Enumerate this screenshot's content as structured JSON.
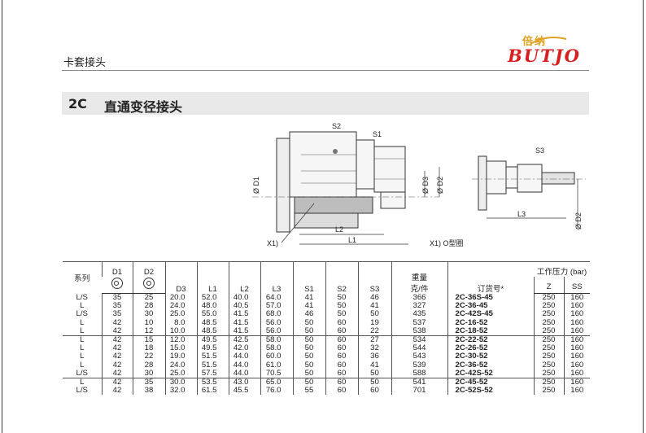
{
  "logo": {
    "top": "倍纳",
    "text": "BUTJO"
  },
  "category_title": "卡套接头",
  "section": {
    "code": "2C",
    "name": "直通变径接头"
  },
  "drawing": {
    "labels": {
      "s1": "S1",
      "s2": "S2",
      "s3": "S3",
      "d1": "Ø D1",
      "d2": "Ø D2",
      "d3": "Ø D3",
      "d2b": "Ø D2",
      "l1": "L1",
      "l2": "L2",
      "l3": "L3",
      "x1": "X1)",
      "note": "X1) O型圈"
    }
  },
  "table": {
    "pressure_header": "工作压力 (bar)",
    "headers": {
      "series": "系列",
      "d1": "D1",
      "d2": "D2",
      "d3": "D3",
      "l1": "L1",
      "l2": "L2",
      "l3": "L3",
      "s1": "S1",
      "s2": "S2",
      "s3": "S3",
      "weight": "重量\n克/件",
      "order": "订货号*",
      "z": "Z",
      "ss": "SS"
    },
    "groups": [
      [
        [
          "L/S",
          "35",
          "25",
          "20.0",
          "52.0",
          "40.0",
          "64.0",
          "41",
          "50",
          "46",
          "366",
          "2C-36S-45",
          "250",
          "160"
        ],
        [
          "L",
          "35",
          "28",
          "24.0",
          "48.0",
          "40.5",
          "57.0",
          "41",
          "50",
          "41",
          "327",
          "2C-36-45",
          "250",
          "160"
        ],
        [
          "L/S",
          "35",
          "30",
          "25.0",
          "55.0",
          "41.5",
          "68.0",
          "46",
          "50",
          "50",
          "435",
          "2C-42S-45",
          "250",
          "160"
        ],
        [
          "L",
          "42",
          "10",
          "8.0",
          "48.5",
          "41.5",
          "56.0",
          "50",
          "60",
          "19",
          "537",
          "2C-16-52",
          "250",
          "160"
        ],
        [
          "L",
          "42",
          "12",
          "10.0",
          "48.5",
          "41.5",
          "56.0",
          "50",
          "60",
          "22",
          "538",
          "2C-18-52",
          "250",
          "160"
        ]
      ],
      [
        [
          "L",
          "42",
          "15",
          "12.0",
          "49.5",
          "42.5",
          "58.0",
          "50",
          "60",
          "27",
          "534",
          "2C-22-52",
          "250",
          "160"
        ],
        [
          "L",
          "42",
          "18",
          "15.0",
          "49.5",
          "42.0",
          "58.0",
          "50",
          "60",
          "32",
          "544",
          "2C-26-52",
          "250",
          "160"
        ],
        [
          "L",
          "42",
          "22",
          "19.0",
          "51.5",
          "44.0",
          "60.0",
          "50",
          "60",
          "36",
          "543",
          "2C-30-52",
          "250",
          "160"
        ],
        [
          "L",
          "42",
          "28",
          "24.0",
          "51.5",
          "44.0",
          "61.0",
          "50",
          "60",
          "41",
          "539",
          "2C-36-52",
          "250",
          "160"
        ],
        [
          "L/S",
          "42",
          "30",
          "25.0",
          "57.5",
          "44.0",
          "70.5",
          "50",
          "60",
          "50",
          "588",
          "2C-42S-52",
          "250",
          "160"
        ]
      ],
      [
        [
          "L",
          "42",
          "35",
          "30.0",
          "53.5",
          "43.0",
          "65.0",
          "50",
          "60",
          "50",
          "541",
          "2C-45-52",
          "250",
          "160"
        ],
        [
          "L/S",
          "42",
          "38",
          "32.0",
          "61.5",
          "45.5",
          "76.0",
          "55",
          "60",
          "60",
          "701",
          "2C-52S-52",
          "250",
          "160"
        ]
      ]
    ]
  }
}
